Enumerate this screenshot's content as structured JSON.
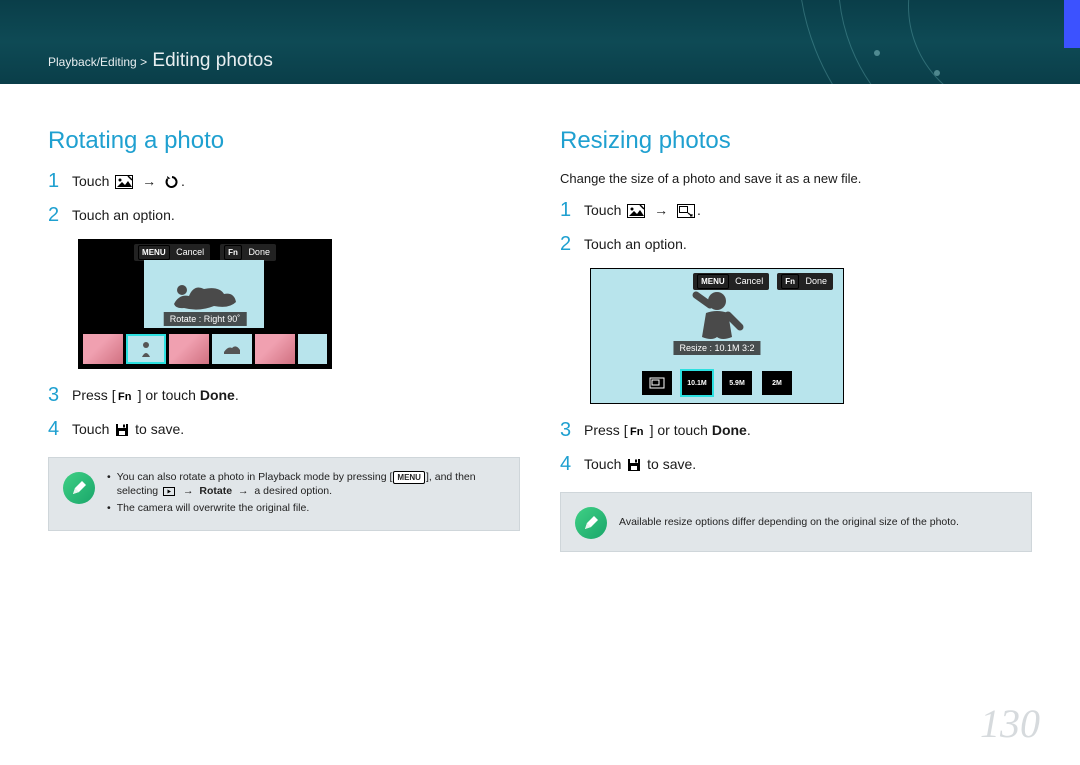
{
  "header": {
    "section": "Playback/Editing",
    "title": "Editing photos"
  },
  "left": {
    "title": "Rotating a photo",
    "steps": [
      {
        "num": "1",
        "pre": "Touch "
      },
      {
        "num": "2",
        "text": "Touch an option."
      },
      {
        "num": "3",
        "pre": "Press ",
        "mid": " or touch ",
        "done": "Done"
      },
      {
        "num": "4",
        "pre": "Touch ",
        "post": " to save."
      }
    ],
    "shot": {
      "cancel": "Cancel",
      "done": "Done",
      "caption": "Rotate : Right 90˚"
    },
    "note": {
      "0": {
        "a": "You can also rotate a photo in Playback mode by pressing ",
        "b": ", and then selecting ",
        "rotate": "Rotate",
        "c": "a desired option."
      },
      "1": "The camera will overwrite the original file."
    }
  },
  "right": {
    "title": "Resizing photos",
    "intro": "Change the size of a photo and save it as a new file.",
    "steps": [
      {
        "num": "1",
        "pre": "Touch "
      },
      {
        "num": "2",
        "text": "Touch an option."
      },
      {
        "num": "3",
        "pre": "Press ",
        "mid": " or touch ",
        "done": "Done"
      },
      {
        "num": "4",
        "pre": "Touch ",
        "post": " to save."
      }
    ],
    "shot": {
      "cancel": "Cancel",
      "done": "Done",
      "caption": "Resize : 10.1M 3:2",
      "opts": [
        "10.1M",
        "5.9M",
        "2M"
      ]
    },
    "note": "Available resize options differ depending on the original size of the photo."
  },
  "page_number": "130"
}
